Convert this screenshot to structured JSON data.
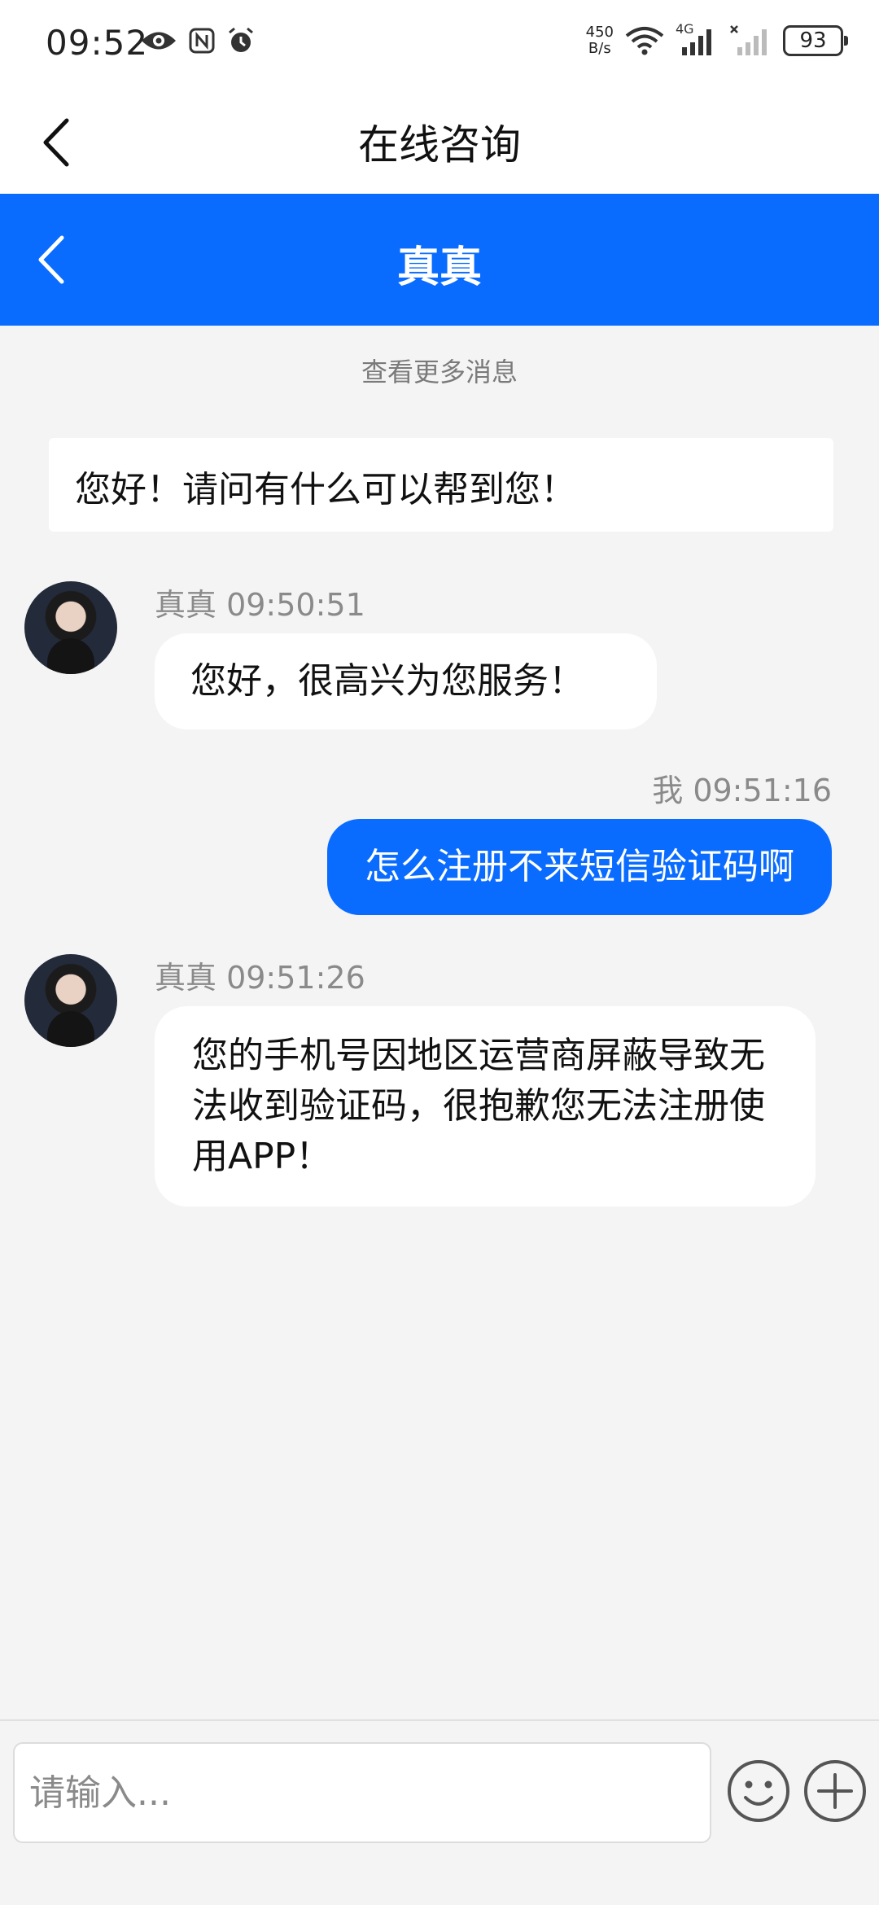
{
  "status_bar": {
    "time": "09:52",
    "net_speed_value": "450",
    "net_speed_unit": "B/s",
    "network_type": "4G",
    "battery_level": "93",
    "icons": [
      "eye-icon",
      "nfc-icon",
      "alarm-icon",
      "wifi-icon",
      "signal-icon",
      "signal-off-icon",
      "battery-icon"
    ]
  },
  "title_bar": {
    "title": "在线咨询"
  },
  "chat_header": {
    "title": "真真"
  },
  "chat": {
    "load_more": "查看更多消息",
    "system_message": "您好！请问有什么可以帮到您！",
    "messages": [
      {
        "sender": "真真",
        "time": "09:50:51",
        "meta": "真真 09:50:51",
        "text": "您好，很高兴为您服务！",
        "direction": "in"
      },
      {
        "sender": "我",
        "time": "09:51:16",
        "meta": "我 09:51:16",
        "text": "怎么注册不来短信验证码啊",
        "direction": "out"
      },
      {
        "sender": "真真",
        "time": "09:51:26",
        "meta": "真真 09:51:26",
        "text": "您的手机号因地区运营商屏蔽导致无法收到验证码，很抱歉您无法注册使用APP！",
        "direction": "in"
      }
    ]
  },
  "input": {
    "placeholder": "请输入...",
    "value": ""
  },
  "colors": {
    "accent": "#0a6cff",
    "background": "#f4f4f5"
  }
}
